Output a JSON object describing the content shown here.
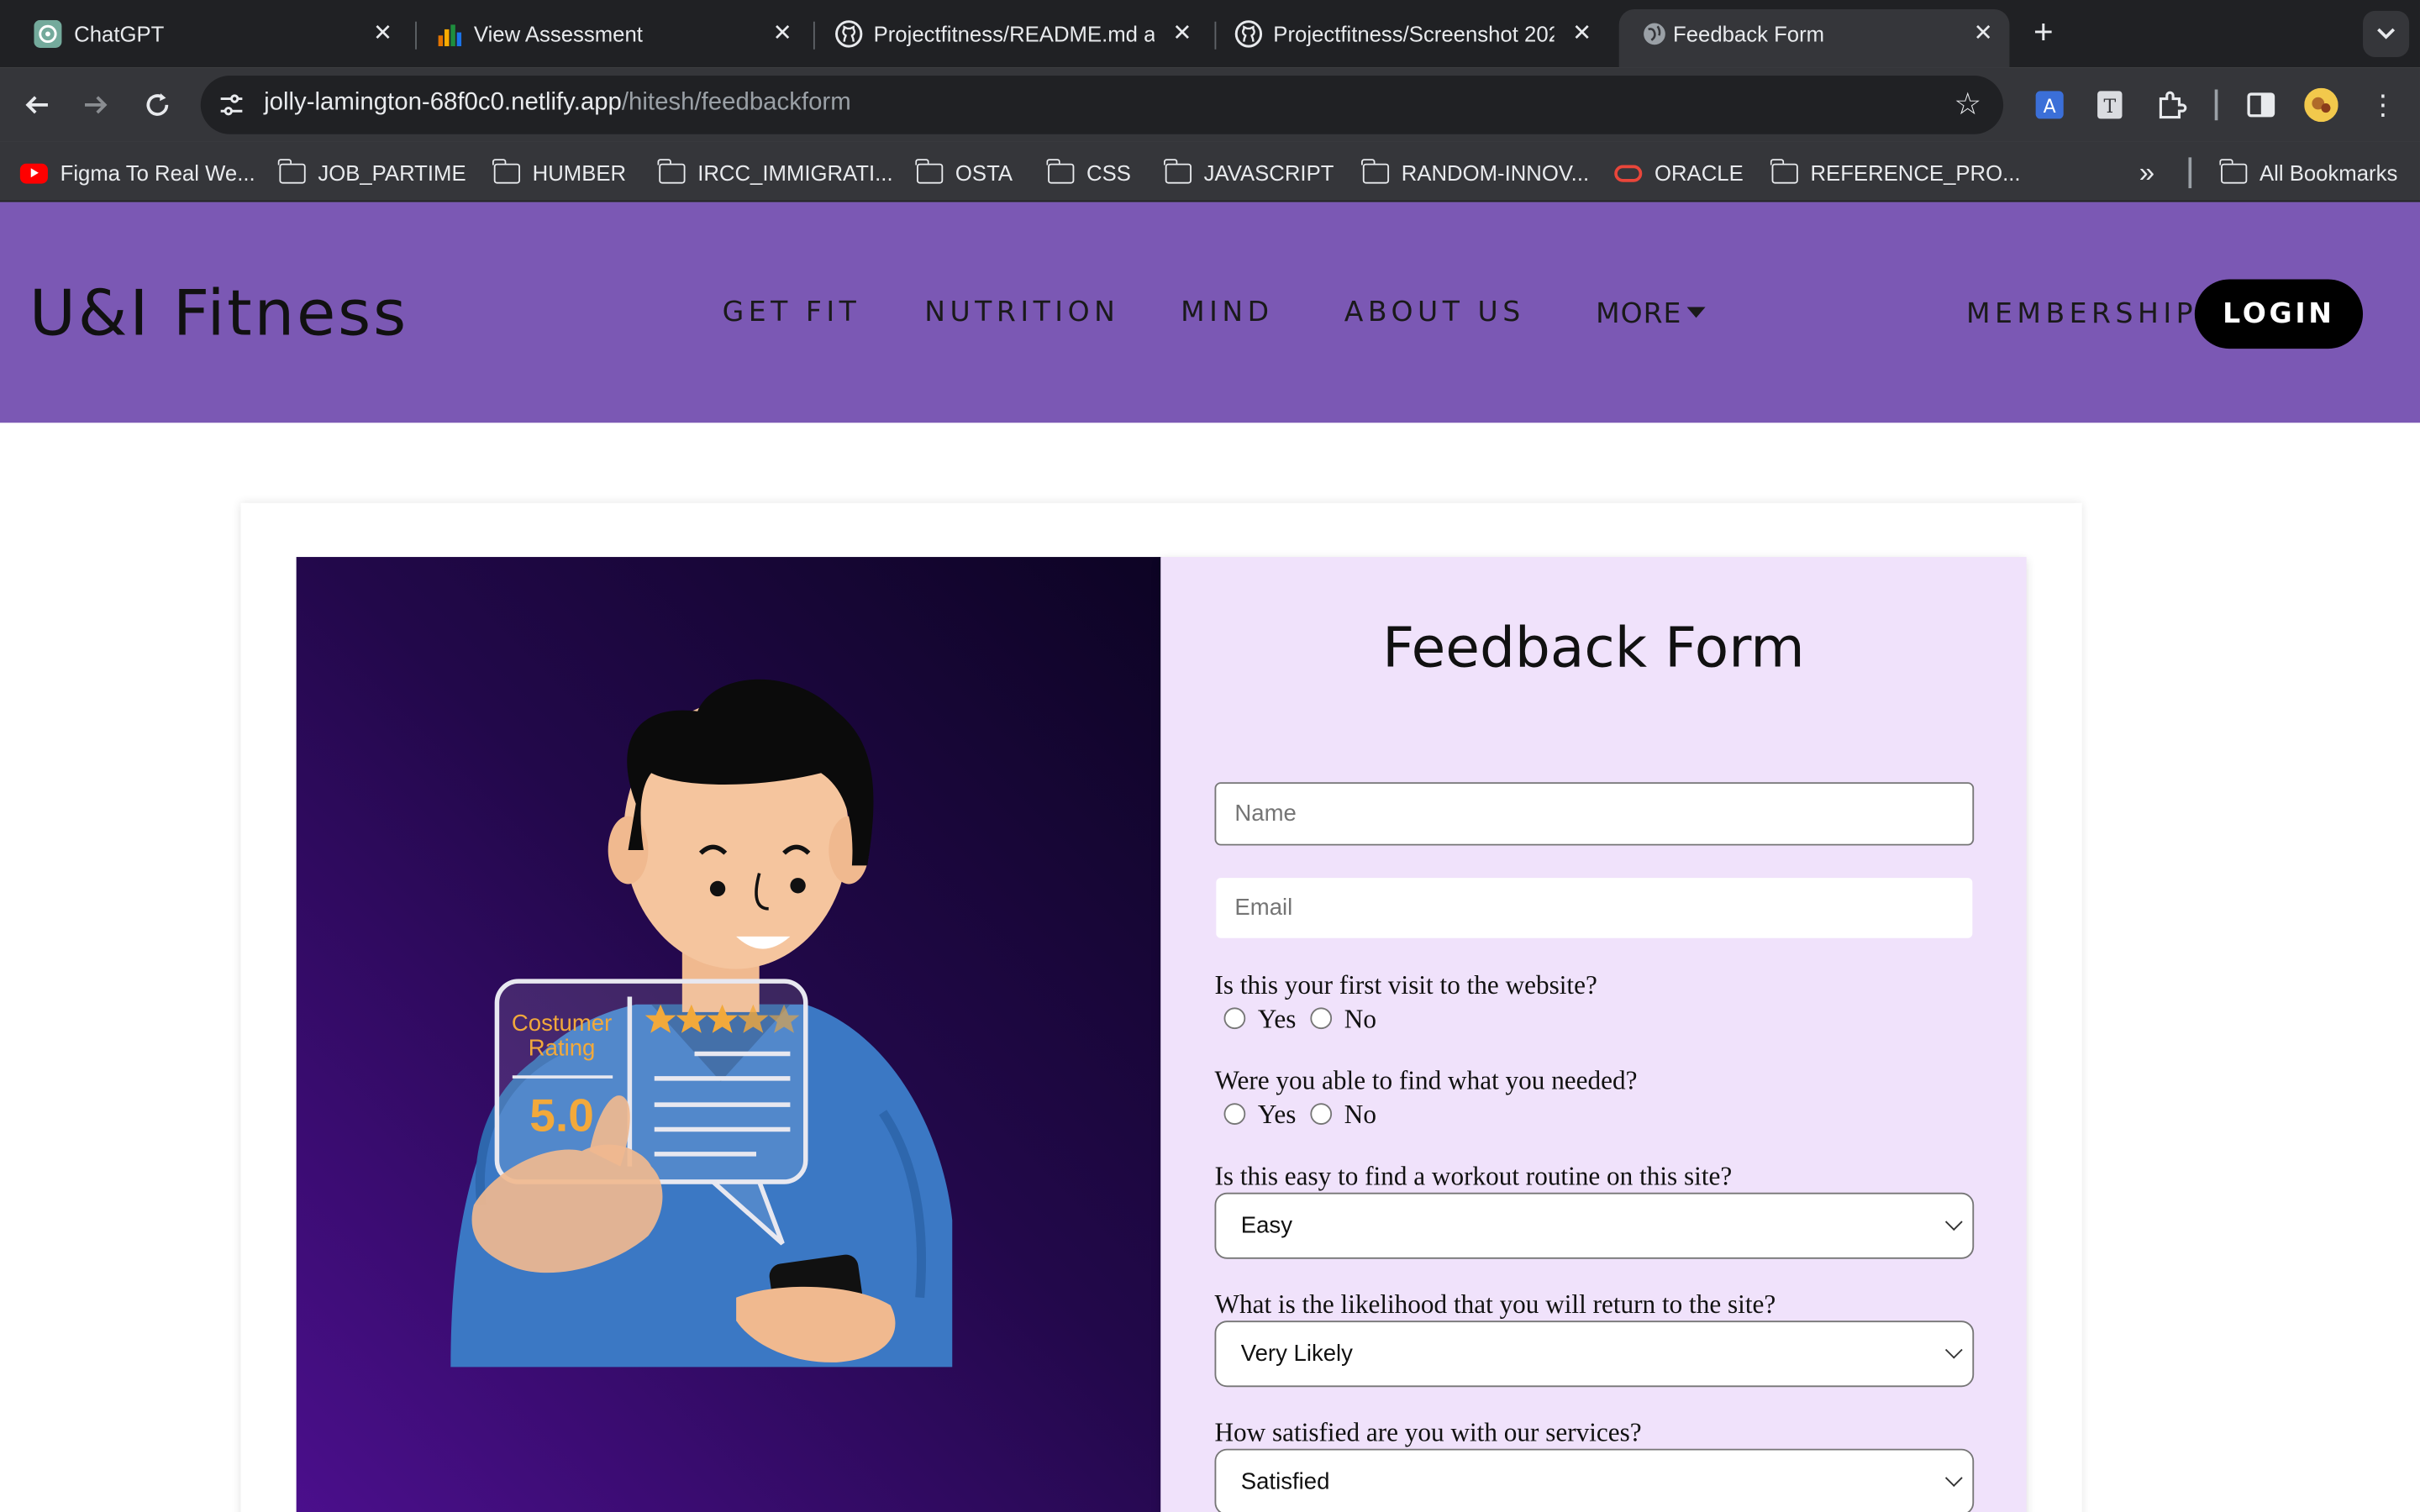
{
  "browser": {
    "tabs": [
      {
        "title": "ChatGPT",
        "icon": "chatgpt-icon"
      },
      {
        "title": "View Assessment",
        "icon": "bar-chart-icon"
      },
      {
        "title": "Projectfitness/README.md at",
        "icon": "github-icon"
      },
      {
        "title": "Projectfitness/Screenshot 202",
        "icon": "github-icon"
      },
      {
        "title": "Feedback Form",
        "icon": "globe-icon",
        "active": true
      }
    ],
    "url_host": "jolly-lamington-68f0c0.netlify.app",
    "url_path": "/hitesh/feedbackform",
    "bookmarks": [
      "Figma To Real We...",
      "JOB_PARTIME",
      "HUMBER",
      "IRCC_IMMIGRATI...",
      "OSTA",
      "CSS",
      "JAVASCRIPT",
      "RANDOM-INNOV...",
      "ORACLE",
      "REFERENCE_PRO..."
    ],
    "all_bookmarks": "All Bookmarks"
  },
  "site": {
    "logo": "U&I Fitness",
    "nav": [
      "GET FIT",
      "NUTRITION",
      "MIND",
      "ABOUT US",
      "MORE"
    ],
    "membership": "MEMBERSHIP",
    "login": "LOGIN"
  },
  "illustration": {
    "rating_label_1": "Costumer",
    "rating_label_2": "Rating",
    "rating_value": "5.0"
  },
  "form": {
    "title": "Feedback Form",
    "name_placeholder": "Name",
    "email_placeholder": "Email",
    "q1": "Is this your first visit to the website?",
    "q2": "Were you able to find what you needed?",
    "yes": "Yes",
    "no": "No",
    "q3": "Is this easy to find a workout routine on this site?",
    "q3_value": "Easy",
    "q4": "What is the likelihood that you will return to the site?",
    "q4_value": "Very Likely",
    "q5": "How satisfied are you with our services?",
    "q5_value": "Satisfied"
  },
  "colors": {
    "header_bg": "#7b58b4",
    "form_panel_bg": "#f0e2fb",
    "login_bg": "#000000",
    "image_gradient_start": "#4c0f8e",
    "image_gradient_end": "#0d0424"
  }
}
